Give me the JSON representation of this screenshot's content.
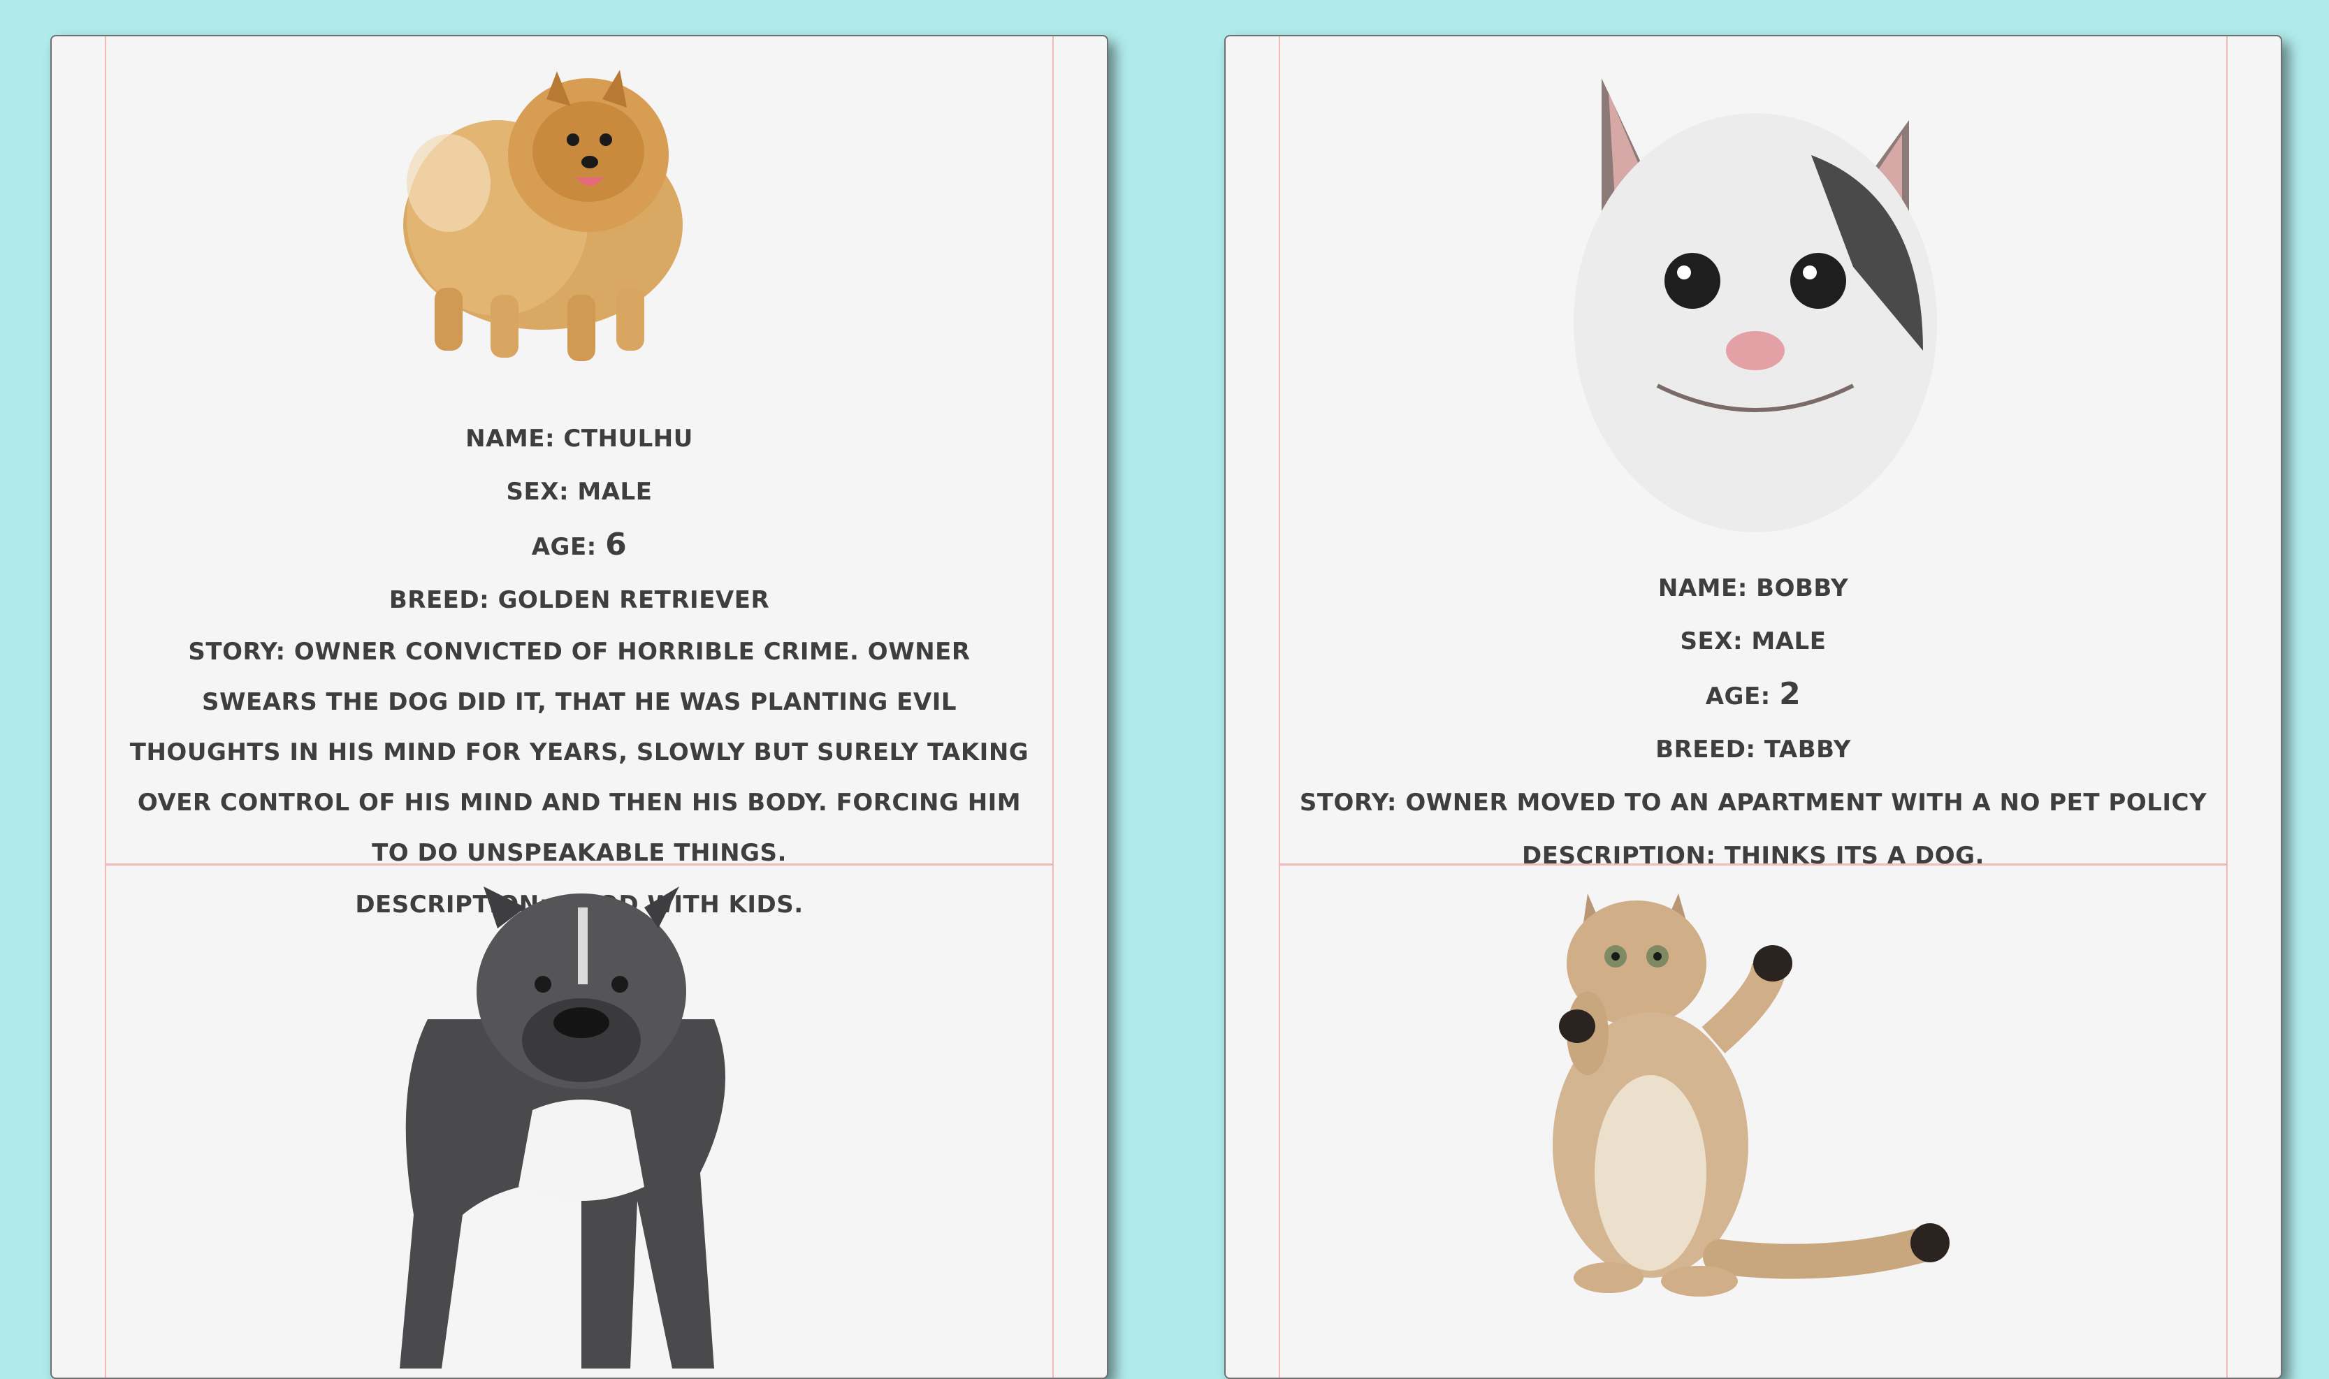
{
  "pets": [
    {
      "image": "pomeranian-dog-photo",
      "name_label": "Name:",
      "name": "Cthulhu",
      "sex_label": "Sex:",
      "sex": "Male",
      "age_label": "Age:",
      "age": "6",
      "breed_label": "Breed:",
      "breed": "Golden Retriever",
      "story_label": "Story:",
      "story": "Owner convicted of horrible crime. Owner swears the dog did it, that he was planting evil thoughts in his mind for years, slowly but surely taking over control of his mind and then his body. Forcing him to do unspeakable things.",
      "description_label": "Description:",
      "description": "Good with kids."
    },
    {
      "image": "smiling-cat-photo",
      "name_label": "Name:",
      "name": "Bobby",
      "sex_label": "Sex:",
      "sex": "Male",
      "age_label": "Age:",
      "age": "2",
      "breed_label": "Breed:",
      "breed": "Tabby",
      "story_label": "Story:",
      "story": "Owner moved to an apartment with a no pet policy",
      "description_label": "Description:",
      "description": "Thinks its a dog."
    },
    {
      "image": "pitbull-dog-photo"
    },
    {
      "image": "standing-cat-photo"
    }
  ],
  "colors": {
    "page_background": "#b0eaea",
    "card_background": "#f5f5f5",
    "divider": "#f2b9b9",
    "text": "#3e3e3e"
  }
}
